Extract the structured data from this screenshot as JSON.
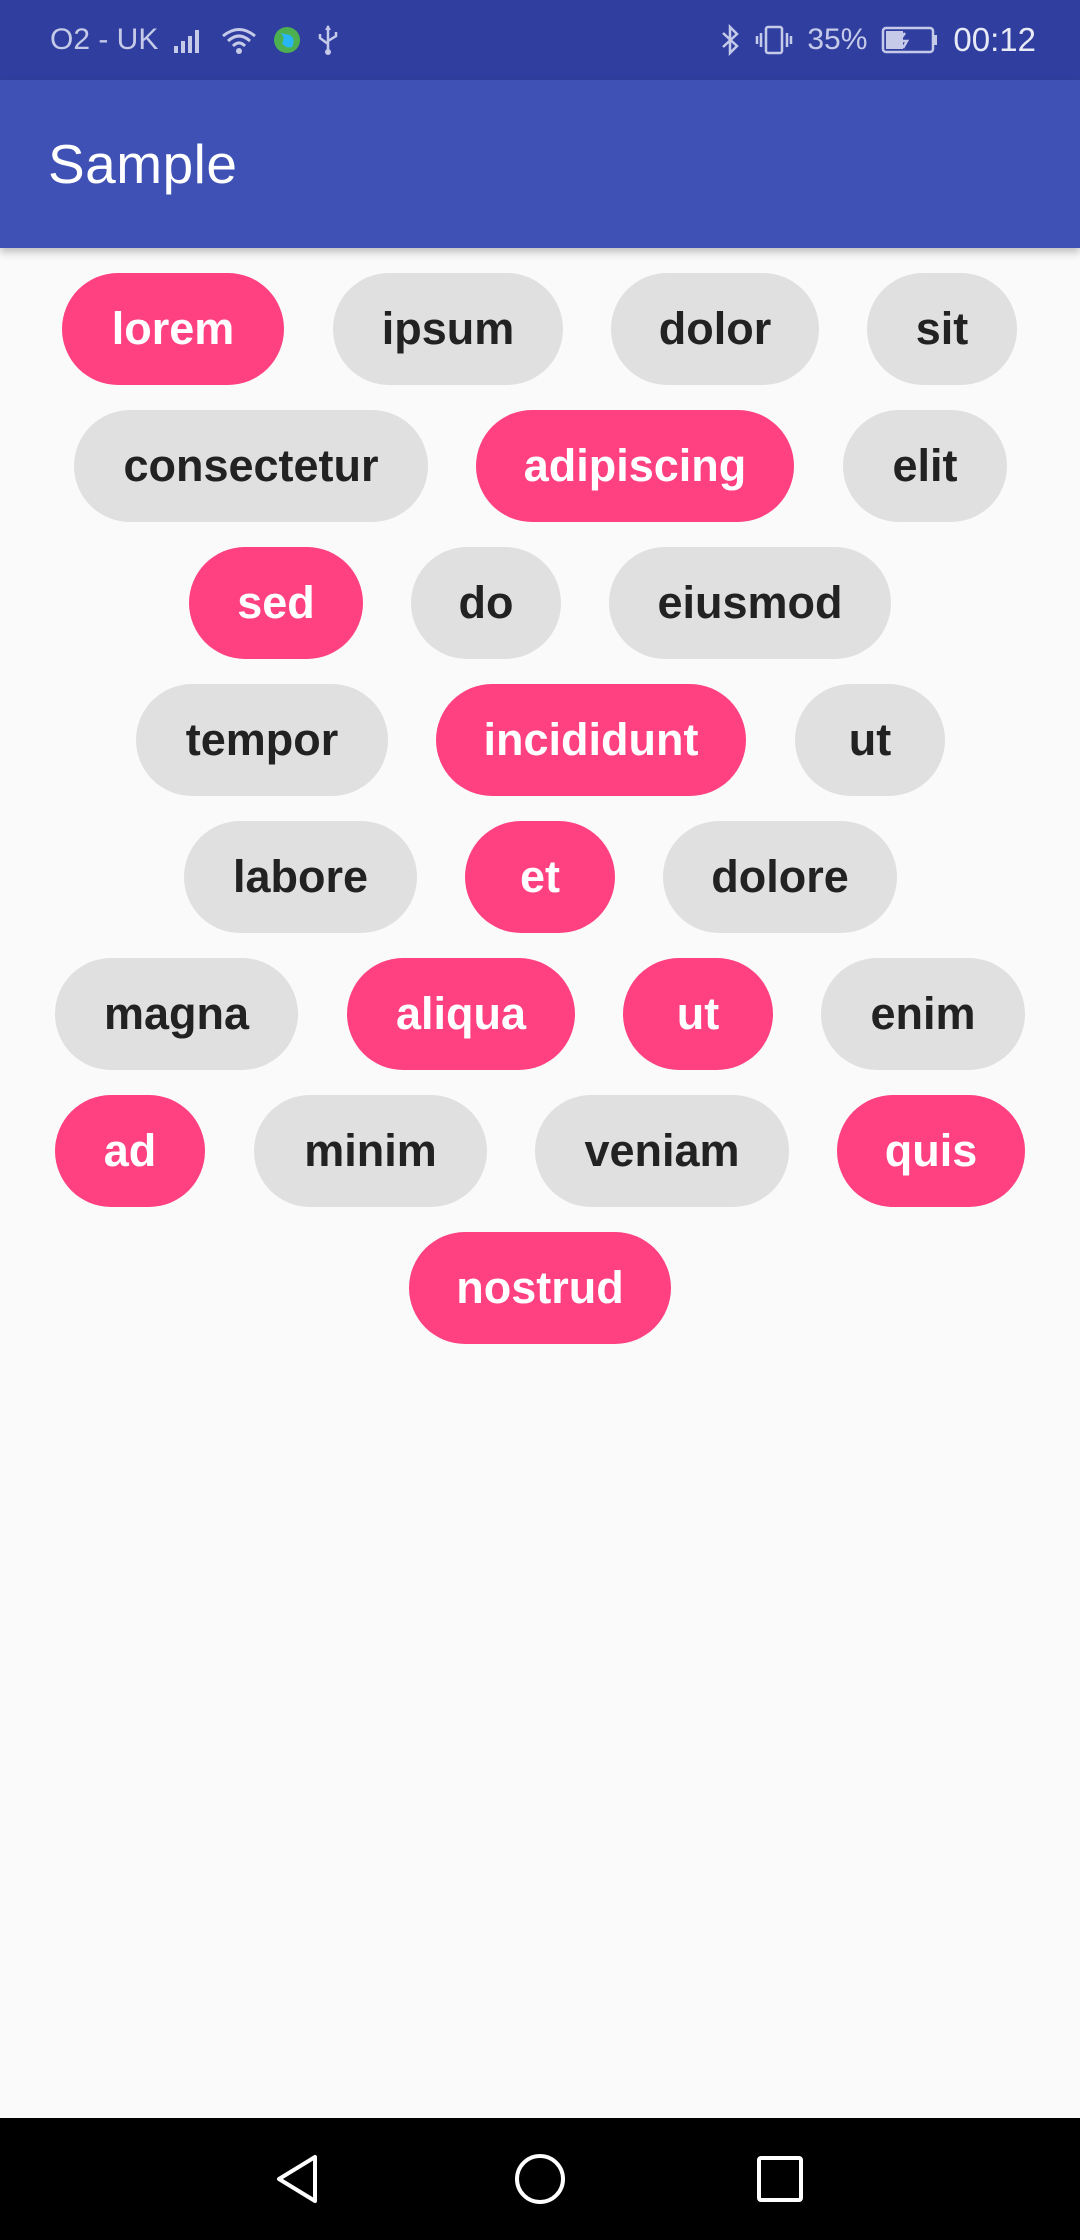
{
  "status_bar": {
    "carrier": "O2 - UK",
    "battery": "35%",
    "time": "00:12",
    "icons": [
      "signal-icon",
      "wifi-icon",
      "globe-icon",
      "usb-icon",
      "bluetooth-icon",
      "vibrate-icon",
      "battery-charging-icon"
    ]
  },
  "app_bar": {
    "title": "Sample"
  },
  "colors": {
    "selected": "#ff4081",
    "unselected": "#e0e0e0",
    "app_bar": "#3f51b5",
    "status_bar": "#303f9f"
  },
  "chips": [
    {
      "label": "lorem",
      "selected": true
    },
    {
      "label": "ipsum",
      "selected": false
    },
    {
      "label": "dolor",
      "selected": false
    },
    {
      "label": "sit",
      "selected": false
    },
    {
      "label": "consectetur",
      "selected": false
    },
    {
      "label": "adipiscing",
      "selected": true
    },
    {
      "label": "elit",
      "selected": false
    },
    {
      "label": "sed",
      "selected": true
    },
    {
      "label": "do",
      "selected": false
    },
    {
      "label": "eiusmod",
      "selected": false
    },
    {
      "label": "tempor",
      "selected": false
    },
    {
      "label": "incididunt",
      "selected": true
    },
    {
      "label": "ut",
      "selected": false
    },
    {
      "label": "labore",
      "selected": false
    },
    {
      "label": "et",
      "selected": true
    },
    {
      "label": "dolore",
      "selected": false
    },
    {
      "label": "magna",
      "selected": false
    },
    {
      "label": "aliqua",
      "selected": true
    },
    {
      "label": "ut",
      "selected": true
    },
    {
      "label": "enim",
      "selected": false
    },
    {
      "label": "ad",
      "selected": true
    },
    {
      "label": "minim",
      "selected": false
    },
    {
      "label": "veniam",
      "selected": false
    },
    {
      "label": "quis",
      "selected": true
    },
    {
      "label": "nostrud",
      "selected": true
    }
  ],
  "nav_bar": {
    "buttons": [
      "back-icon",
      "home-icon",
      "recents-icon"
    ]
  }
}
